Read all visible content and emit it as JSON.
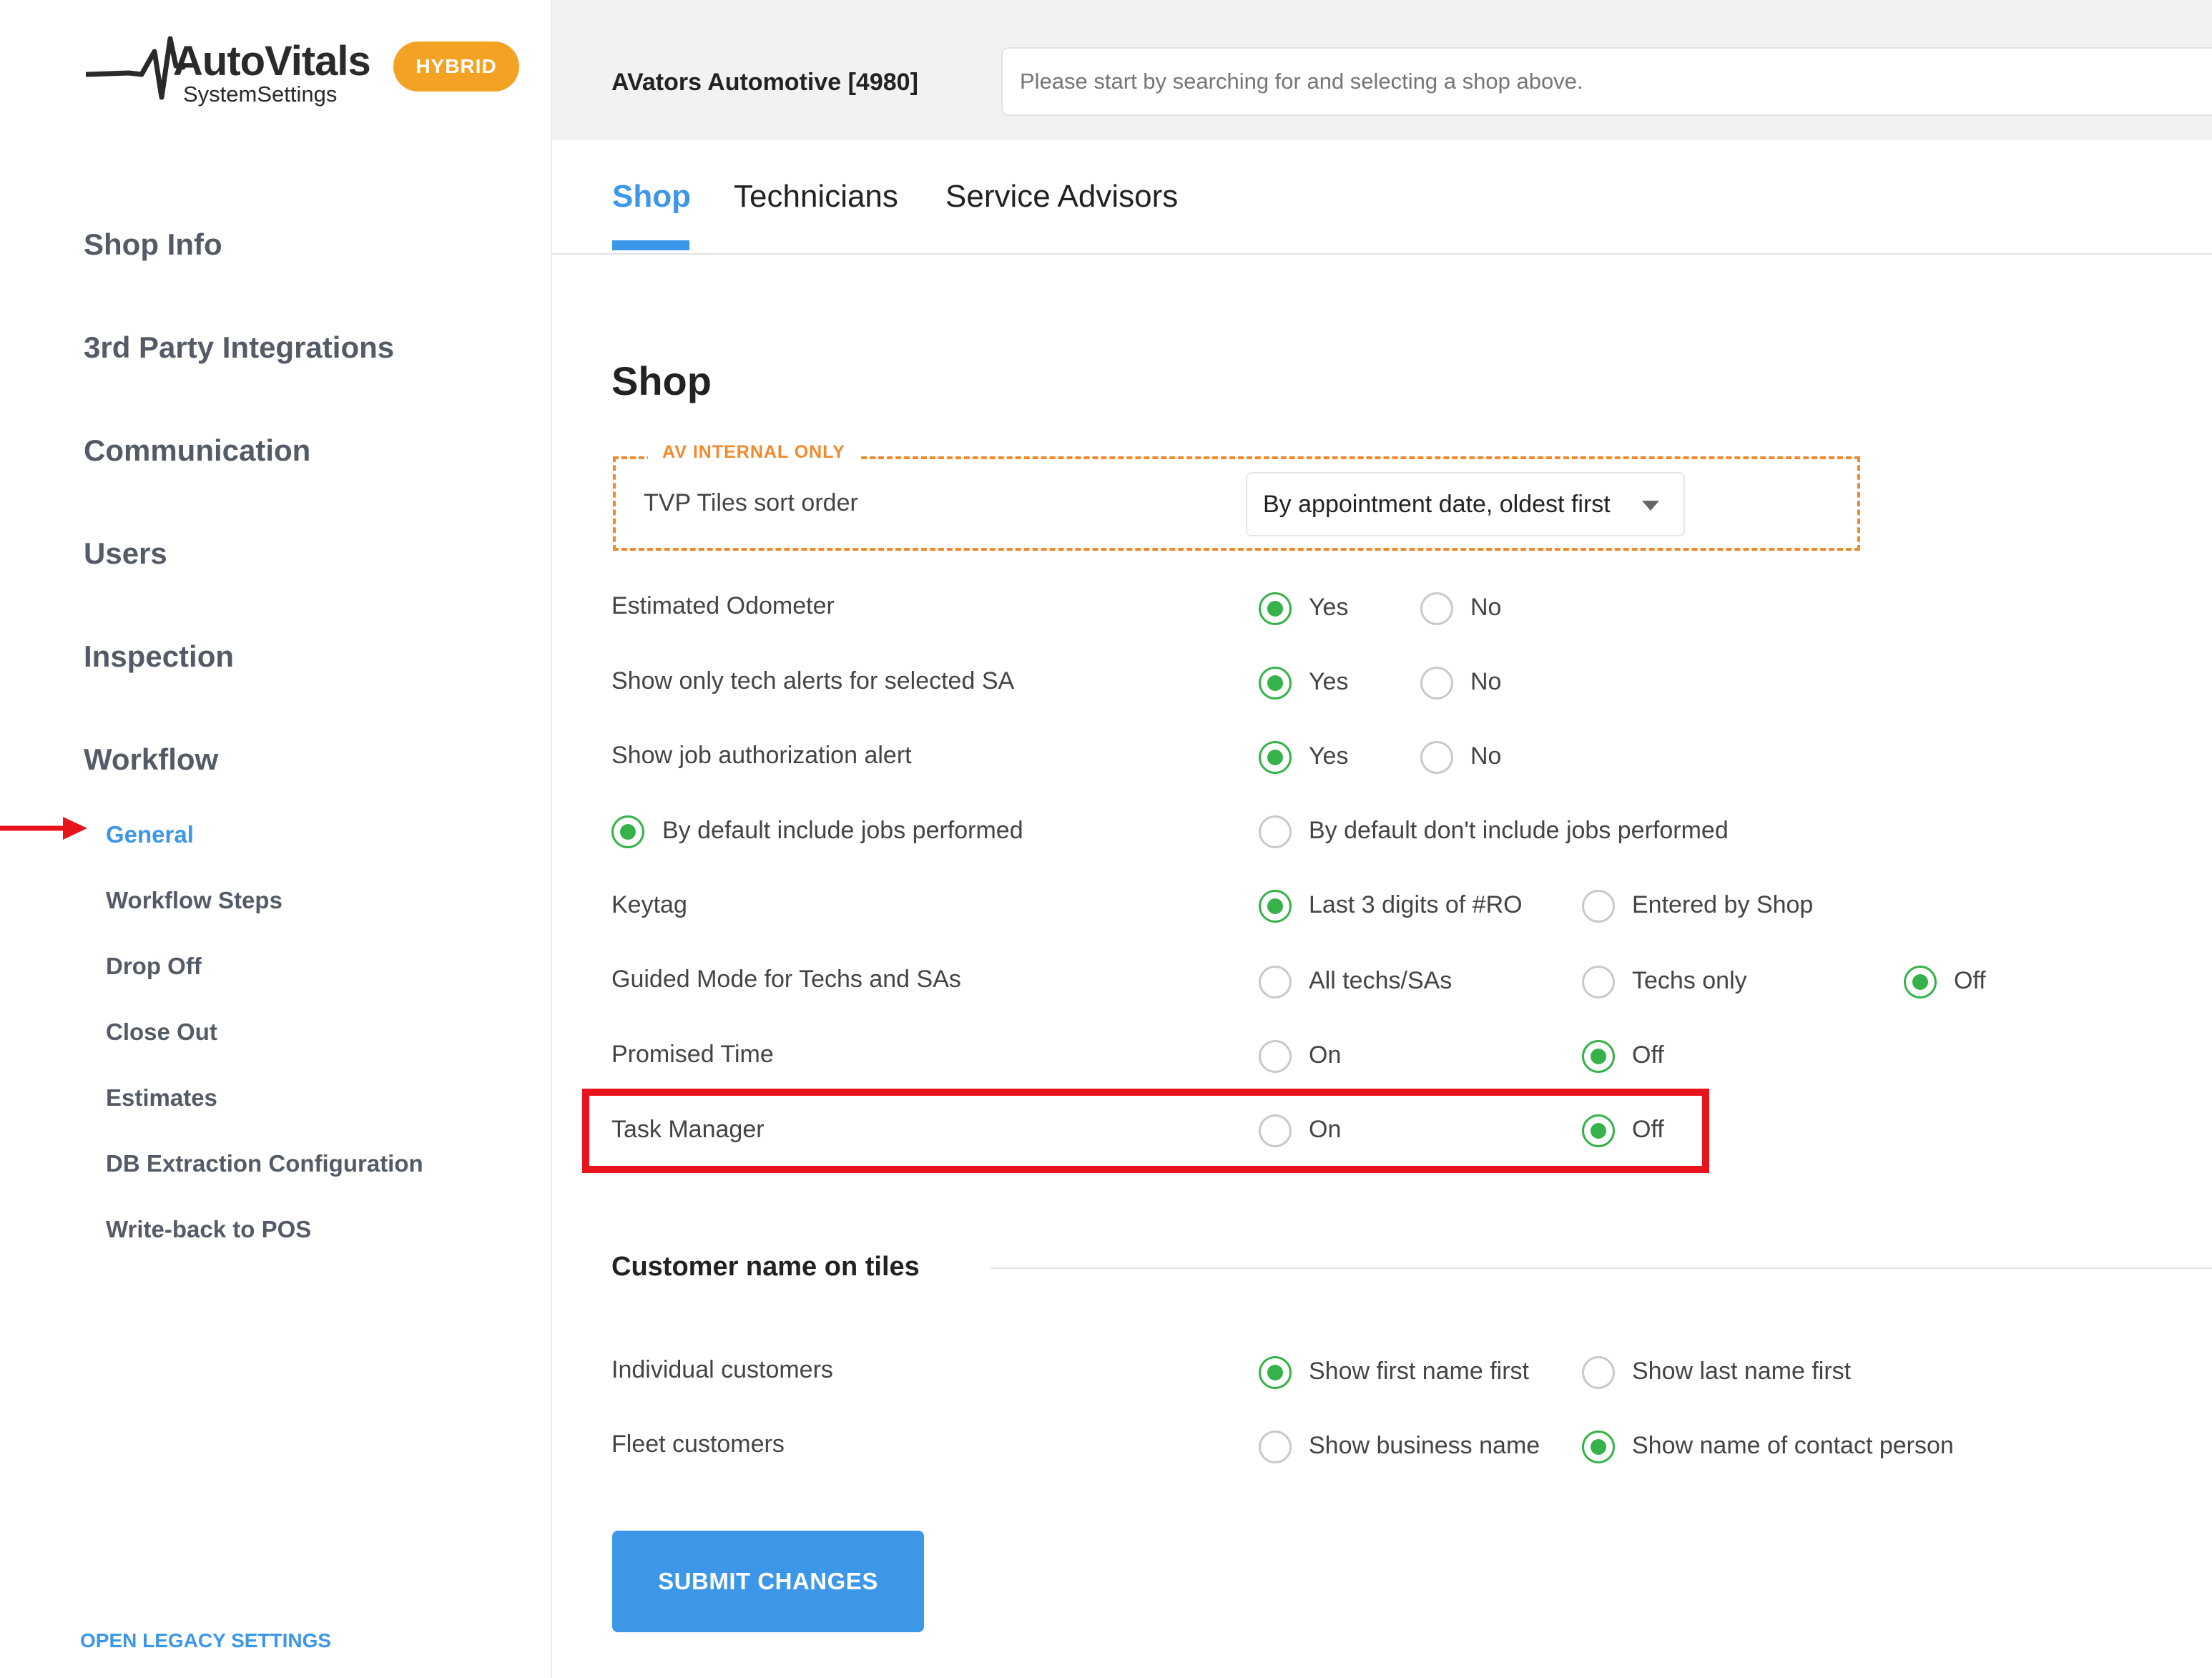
{
  "brand": {
    "name": "AutoVitals",
    "subtitle": "SystemSettings",
    "badge": "HYBRID"
  },
  "sidebar": {
    "main_items": [
      {
        "label": "Shop Info"
      },
      {
        "label": "3rd Party Integrations"
      },
      {
        "label": "Communication"
      },
      {
        "label": "Users"
      },
      {
        "label": "Inspection"
      },
      {
        "label": "Workflow"
      }
    ],
    "sub_items": [
      {
        "label": "General",
        "active": true
      },
      {
        "label": "Workflow Steps"
      },
      {
        "label": "Drop Off"
      },
      {
        "label": "Close Out"
      },
      {
        "label": "Estimates"
      },
      {
        "label": "DB Extraction Configuration"
      },
      {
        "label": "Write-back to POS"
      }
    ],
    "legacy_link": "OPEN LEGACY SETTINGS"
  },
  "header": {
    "shop_name": "AVators Automotive [4980]",
    "search_placeholder": "Please start by searching for and selecting a shop above."
  },
  "tabs": [
    {
      "label": "Shop",
      "active": true
    },
    {
      "label": "Technicians"
    },
    {
      "label": "Service Advisors"
    }
  ],
  "content": {
    "title": "Shop",
    "internal_label": "AV INTERNAL ONLY",
    "tvp_label": "TVP Tiles sort order",
    "tvp_value": "By appointment date, oldest first",
    "rows": {
      "estimated_odometer": {
        "label": "Estimated Odometer",
        "opt1": "Yes",
        "opt2": "No"
      },
      "tech_alerts": {
        "label": "Show only tech alerts for selected SA",
        "opt1": "Yes",
        "opt2": "No"
      },
      "job_auth": {
        "label": "Show job authorization alert",
        "opt1": "Yes",
        "opt2": "No"
      },
      "jobs_performed": {
        "opt1": "By default include jobs performed",
        "opt2": "By default don't include jobs performed"
      },
      "keytag": {
        "label": "Keytag",
        "opt1": "Last 3 digits of #RO",
        "opt2": "Entered by Shop"
      },
      "guided_mode": {
        "label": "Guided Mode for Techs and SAs",
        "opt1": "All techs/SAs",
        "opt2": "Techs only",
        "opt3": "Off"
      },
      "promised_time": {
        "label": "Promised Time",
        "opt1": "On",
        "opt2": "Off"
      },
      "task_manager": {
        "label": "Task Manager",
        "opt1": "On",
        "opt2": "Off"
      }
    },
    "customer_section": {
      "title": "Customer name on tiles",
      "individual": {
        "label": "Individual customers",
        "opt1": "Show first name first",
        "opt2": "Show last name first"
      },
      "fleet": {
        "label": "Fleet customers",
        "opt1": "Show business name",
        "opt2": "Show name of contact person"
      }
    },
    "submit": "SUBMIT CHANGES"
  },
  "colors": {
    "accent": "#3d97e8",
    "radio_checked": "#36b24a",
    "internal_border": "#f08a2c",
    "highlight": "#e8141b",
    "badge": "#f4a223"
  }
}
